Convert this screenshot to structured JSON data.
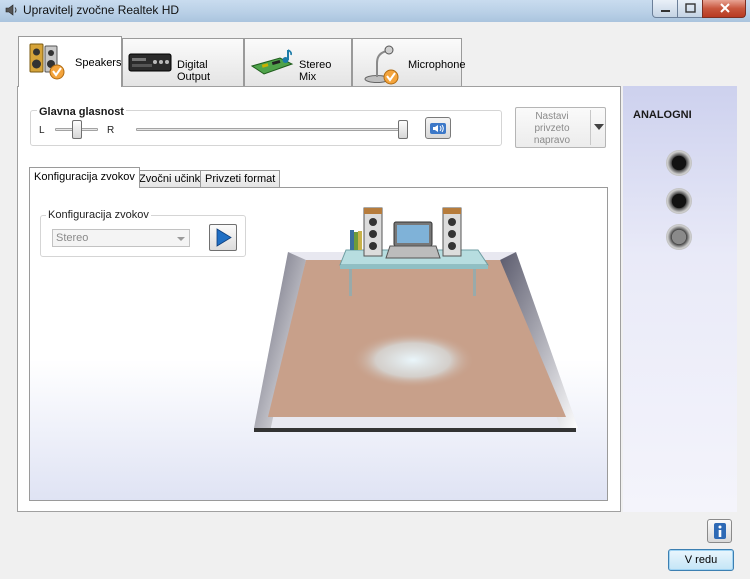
{
  "window": {
    "title": "Upravitelj zvočne Realtek HD"
  },
  "device_tabs": [
    {
      "label": "Speakers",
      "icon": "speakers-icon",
      "active": true
    },
    {
      "label": "Digital Output",
      "icon": "digital-output-icon",
      "active": false
    },
    {
      "label": "Stereo Mix",
      "icon": "sound-card-icon",
      "active": false
    },
    {
      "label": "Microphone",
      "icon": "microphone-icon",
      "active": false
    }
  ],
  "volume": {
    "title": "Glavna glasnost",
    "left_label": "L",
    "right_label": "R",
    "balance": 0.5,
    "level": 1.0
  },
  "default_device": {
    "label": "Nastavi\nprivzeto\nnapravo"
  },
  "inner_tabs": [
    {
      "label": "Konfiguracija zvokov",
      "active": true
    },
    {
      "label": "Zvočni učinki",
      "active": false
    },
    {
      "label": "Privzeti format",
      "active": false
    }
  ],
  "speaker_config": {
    "group_label": "Konfiguracija zvokov",
    "selected": "Stereo"
  },
  "analog": {
    "title": "ANALOGNI",
    "jacks": [
      "black",
      "black",
      "gray"
    ]
  },
  "buttons": {
    "ok": "V redu"
  },
  "colors": {
    "jack_black": "#111111",
    "jack_gray": "#8a8a8a",
    "accent": "#1f6fc4",
    "rug": "#c8a08a"
  }
}
